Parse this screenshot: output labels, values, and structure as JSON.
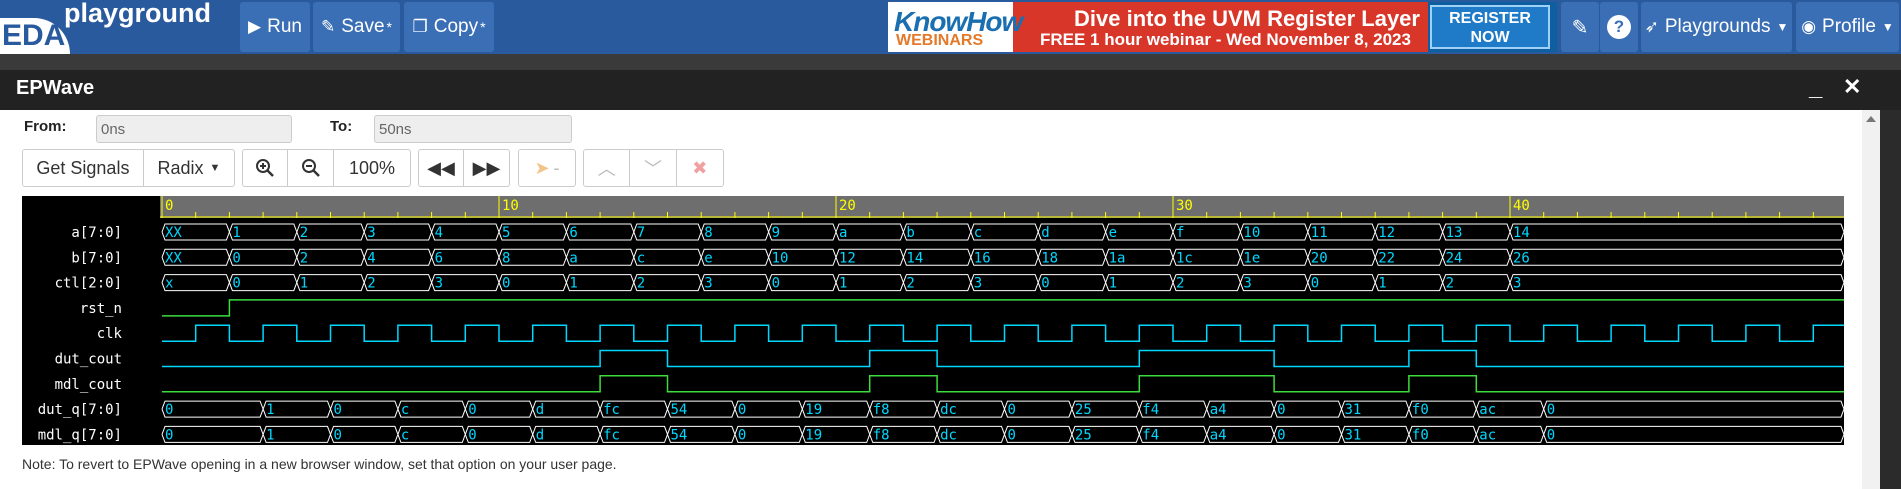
{
  "navbar": {
    "brand_eda": "EDA",
    "brand_playground": "playground",
    "run_label": "Run",
    "save_label": "Save",
    "save_mark": "*",
    "copy_label": "Copy",
    "copy_mark": "*",
    "playgrounds_label": "Playgrounds",
    "profile_label": "Profile",
    "help_label": "?"
  },
  "banner": {
    "brand_top": "KnowHow",
    "brand_bottom": "WEBINARS",
    "line1": "Dive into the UVM Register Layer",
    "line2": "FREE 1 hour webinar - Wed November 8, 2023",
    "cta_line1": "REGISTER",
    "cta_line2": "NOW"
  },
  "window": {
    "title": "EPWave",
    "minimize": "_",
    "close": "✕"
  },
  "range": {
    "from_label": "From:",
    "from_value": "0ns",
    "to_label": "To:",
    "to_value": "50ns"
  },
  "toolbar": {
    "get_signals": "Get Signals",
    "radix": "Radix",
    "zoom_level": "100%",
    "cursor_dash": "-"
  },
  "colors": {
    "navbar": "#2a5a9e",
    "wave_cyan": "#00d8ff",
    "wave_green": "#3cdc3c",
    "ruler_yellow": "#ffff00",
    "bus_line": "#ffffff"
  },
  "waveform": {
    "ruler_ticks": [
      "0",
      "10",
      "20",
      "30",
      "40"
    ],
    "signals": [
      {
        "name": "a[7:0]",
        "kind": "bus",
        "changes": [
          0,
          2,
          4,
          6,
          8,
          10,
          12,
          14,
          16,
          18,
          20,
          22,
          24,
          26,
          28,
          30,
          32,
          34,
          36,
          38,
          40
        ],
        "values": [
          "XX",
          "1",
          "2",
          "3",
          "4",
          "5",
          "6",
          "7",
          "8",
          "9",
          "a",
          "b",
          "c",
          "d",
          "e",
          "f",
          "10",
          "11",
          "12",
          "13",
          "14"
        ]
      },
      {
        "name": "b[7:0]",
        "kind": "bus",
        "changes": [
          0,
          2,
          4,
          6,
          8,
          10,
          12,
          14,
          16,
          18,
          20,
          22,
          24,
          26,
          28,
          30,
          32,
          34,
          36,
          38,
          40
        ],
        "values": [
          "XX",
          "0",
          "2",
          "4",
          "6",
          "8",
          "a",
          "c",
          "e",
          "10",
          "12",
          "14",
          "16",
          "18",
          "1a",
          "1c",
          "1e",
          "20",
          "22",
          "24",
          "26"
        ]
      },
      {
        "name": "ctl[2:0]",
        "kind": "bus",
        "changes": [
          0,
          2,
          4,
          6,
          8,
          10,
          12,
          14,
          16,
          18,
          20,
          22,
          24,
          26,
          28,
          30,
          32,
          34,
          36,
          38,
          40
        ],
        "values": [
          "x",
          "0",
          "1",
          "2",
          "3",
          "0",
          "1",
          "2",
          "3",
          "0",
          "1",
          "2",
          "3",
          "0",
          "1",
          "2",
          "3",
          "0",
          "1",
          "2",
          "3"
        ]
      },
      {
        "name": "rst_n",
        "kind": "bit",
        "color": "green",
        "init": 0,
        "edges": [
          2
        ]
      },
      {
        "name": "clk",
        "kind": "clock",
        "color": "cyan",
        "start": 1,
        "period": 2,
        "high_first": true
      },
      {
        "name": "dut_cout",
        "kind": "bit",
        "color": "cyan",
        "init": 0,
        "edges": [
          13,
          15,
          21,
          23,
          29,
          33,
          37,
          39
        ]
      },
      {
        "name": "mdl_cout",
        "kind": "bit",
        "color": "green",
        "init": 0,
        "edges": [
          13,
          15,
          21,
          23,
          29,
          33,
          37,
          39
        ]
      },
      {
        "name": "dut_q[7:0]",
        "kind": "bus",
        "changes": [
          0,
          3,
          5,
          7,
          9,
          11,
          13,
          15,
          17,
          19,
          21,
          23,
          25,
          27,
          29,
          31,
          33,
          35,
          37,
          39,
          41
        ],
        "values": [
          "0",
          "1",
          "0",
          "c",
          "0",
          "d",
          "fc",
          "54",
          "0",
          "19",
          "f8",
          "dc",
          "0",
          "25",
          "f4",
          "a4",
          "0",
          "31",
          "f0",
          "ac",
          "0"
        ]
      },
      {
        "name": "mdl_q[7:0]",
        "kind": "bus",
        "changes": [
          0,
          3,
          5,
          7,
          9,
          11,
          13,
          15,
          17,
          19,
          21,
          23,
          25,
          27,
          29,
          31,
          33,
          35,
          37,
          39,
          41
        ],
        "values": [
          "0",
          "1",
          "0",
          "c",
          "0",
          "d",
          "fc",
          "54",
          "0",
          "19",
          "f8",
          "dc",
          "0",
          "25",
          "f4",
          "a4",
          "0",
          "31",
          "f0",
          "ac",
          "0"
        ]
      }
    ]
  },
  "note": "Note: To revert to EPWave opening in a new browser window, set that option on your user page."
}
